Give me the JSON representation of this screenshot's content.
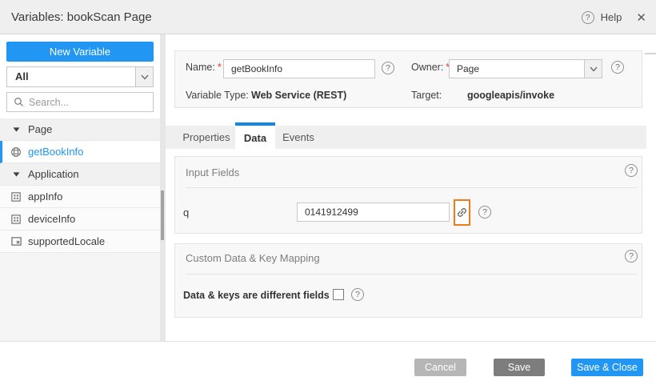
{
  "colors": {
    "accent_blue": "#2196f3",
    "tab_accent_blue": "#1287e8",
    "highlight_orange": "#ee7c19",
    "cancel_gray": "#b6b6b6",
    "save_gray": "#7d7d7d"
  },
  "header": {
    "title": "Variables: bookScan Page",
    "help_label": "Help"
  },
  "sidebar": {
    "new_variable_label": "New Variable",
    "filter_value": "All",
    "search_placeholder": "Search...",
    "tree": [
      {
        "label": "Page"
      },
      {
        "label": "getBookInfo"
      },
      {
        "label": "Application"
      },
      {
        "label": "appInfo"
      },
      {
        "label": "deviceInfo"
      },
      {
        "label": "supportedLocale"
      }
    ]
  },
  "summary": {
    "name_label": "Name:",
    "required_marker": "*",
    "name_value": "getBookInfo",
    "owner_label": "Owner:",
    "owner_value": "Page",
    "variable_type_label": "Variable Type:",
    "variable_type_value": "Web Service (REST)",
    "target_label": "Target:",
    "target_value": "googleapis/invoke"
  },
  "tabs": {
    "properties": "Properties",
    "data": "Data",
    "events": "Events"
  },
  "input_fields": {
    "section_title": "Input Fields",
    "param_label": "q",
    "param_value": "0141912499"
  },
  "custom_mapping": {
    "section_title": "Custom Data & Key Mapping",
    "checkbox_label": "Data & keys are different fields",
    "checkbox_checked": false
  },
  "footer": {
    "cancel_label": "Cancel",
    "save_label": "Save",
    "save_close_label": "Save & Close"
  }
}
